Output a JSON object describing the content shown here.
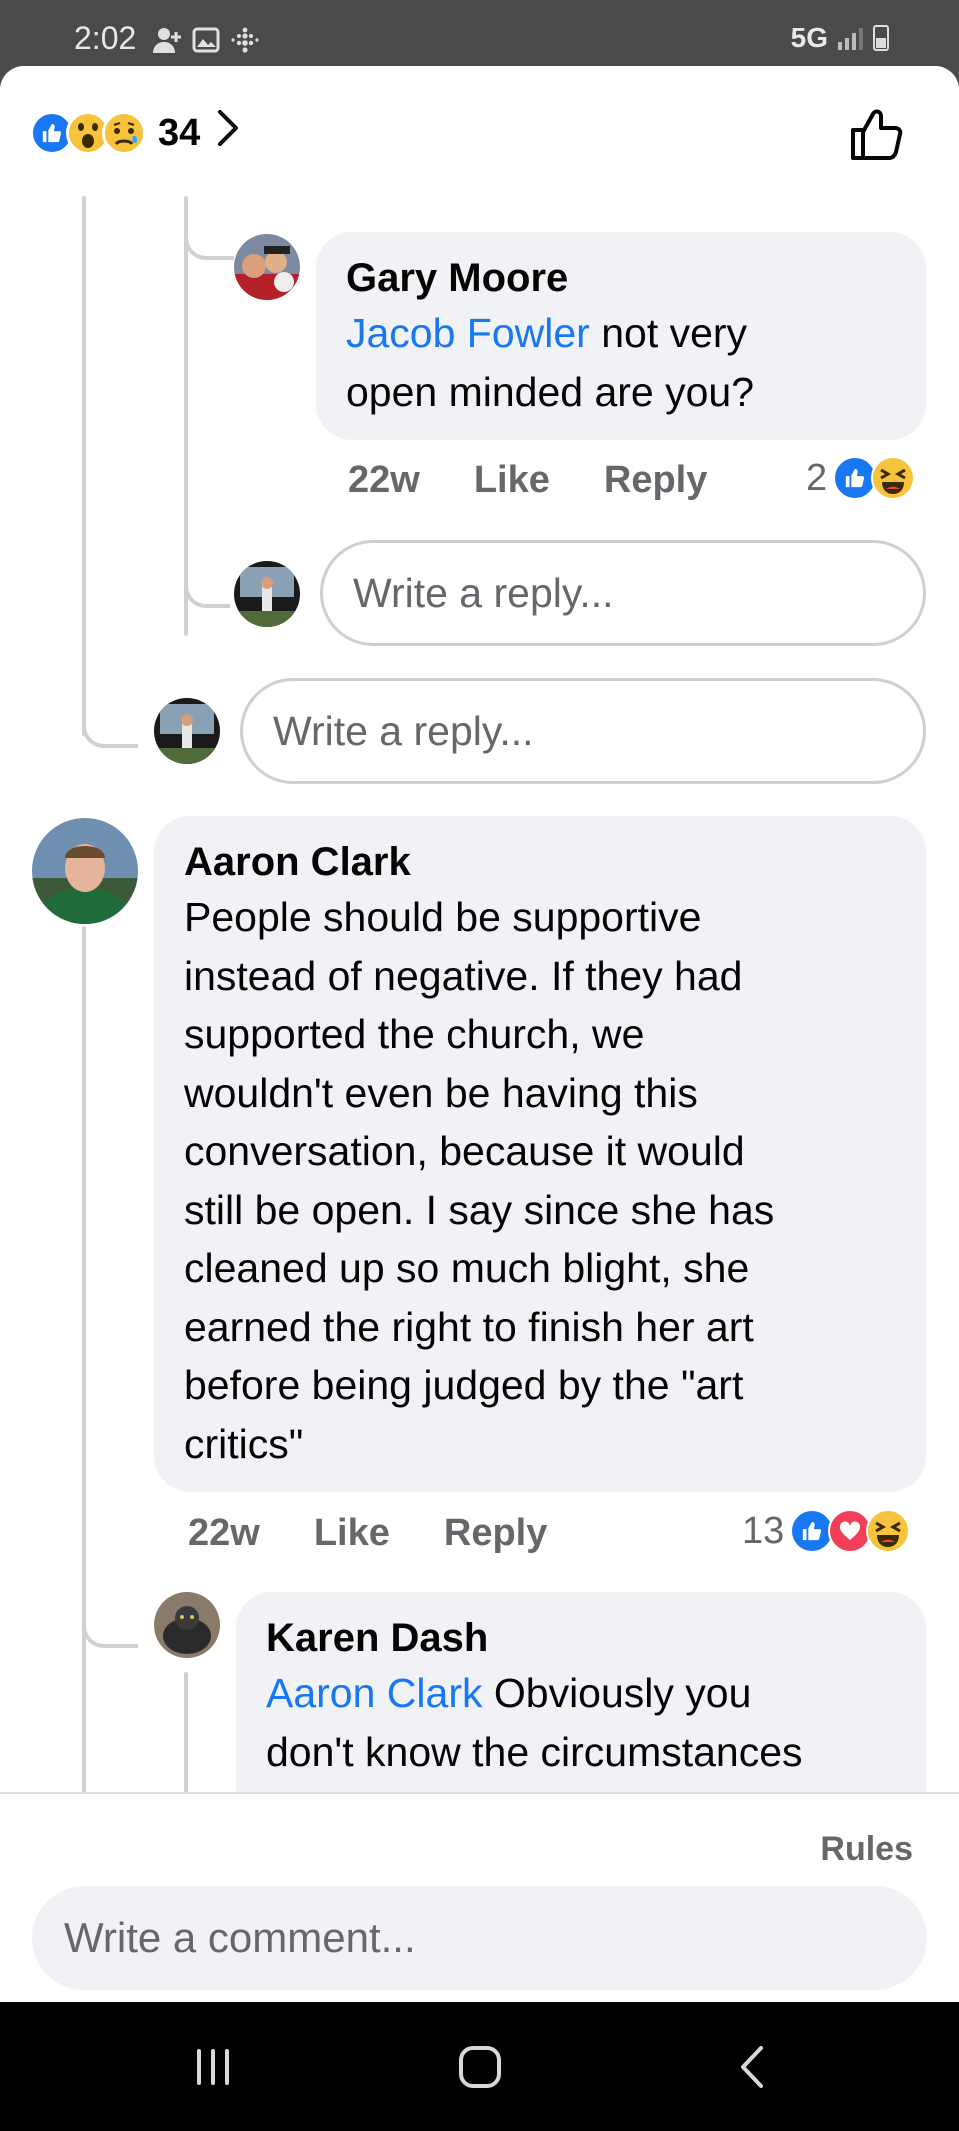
{
  "status_bar": {
    "time": "2:02",
    "network": "5G"
  },
  "header": {
    "reaction_count": "34",
    "reaction_icons": [
      "like-icon",
      "wow-icon",
      "sad-icon"
    ]
  },
  "comments": {
    "gary": {
      "name": "Gary Moore",
      "mention": "Jacob Fowler",
      "text_line1_rest": " not very",
      "text_line2": "open minded are you?",
      "time": "22w",
      "like": "Like",
      "reply": "Reply",
      "reaction_count": "2",
      "reaction_icons": [
        "like-icon",
        "haha-icon"
      ]
    },
    "aaron": {
      "name": "Aaron Clark",
      "lines": [
        "People should be supportive",
        "instead of negative. If they had",
        "supported the church, we",
        "wouldn't even be having this",
        "conversation, because it would",
        "still be open.  I say since she has",
        "cleaned up so much blight, she",
        "earned the right to finish her art",
        "before being judged by the \"art",
        "critics\""
      ],
      "time": "22w",
      "like": "Like",
      "reply": "Reply",
      "reaction_count": "13",
      "reaction_icons": [
        "like-icon",
        "love-icon",
        "haha-icon"
      ]
    },
    "karen": {
      "name": "Karen Dash",
      "mention": "Aaron Clark",
      "text_line1_rest": " Obviously you",
      "text_line2": "don't know the circumstances"
    }
  },
  "inputs": {
    "reply_placeholder_1": "Write a reply...",
    "reply_placeholder_2": "Write a reply...",
    "comment_placeholder": "Write a comment..."
  },
  "footer": {
    "rules": "Rules"
  }
}
